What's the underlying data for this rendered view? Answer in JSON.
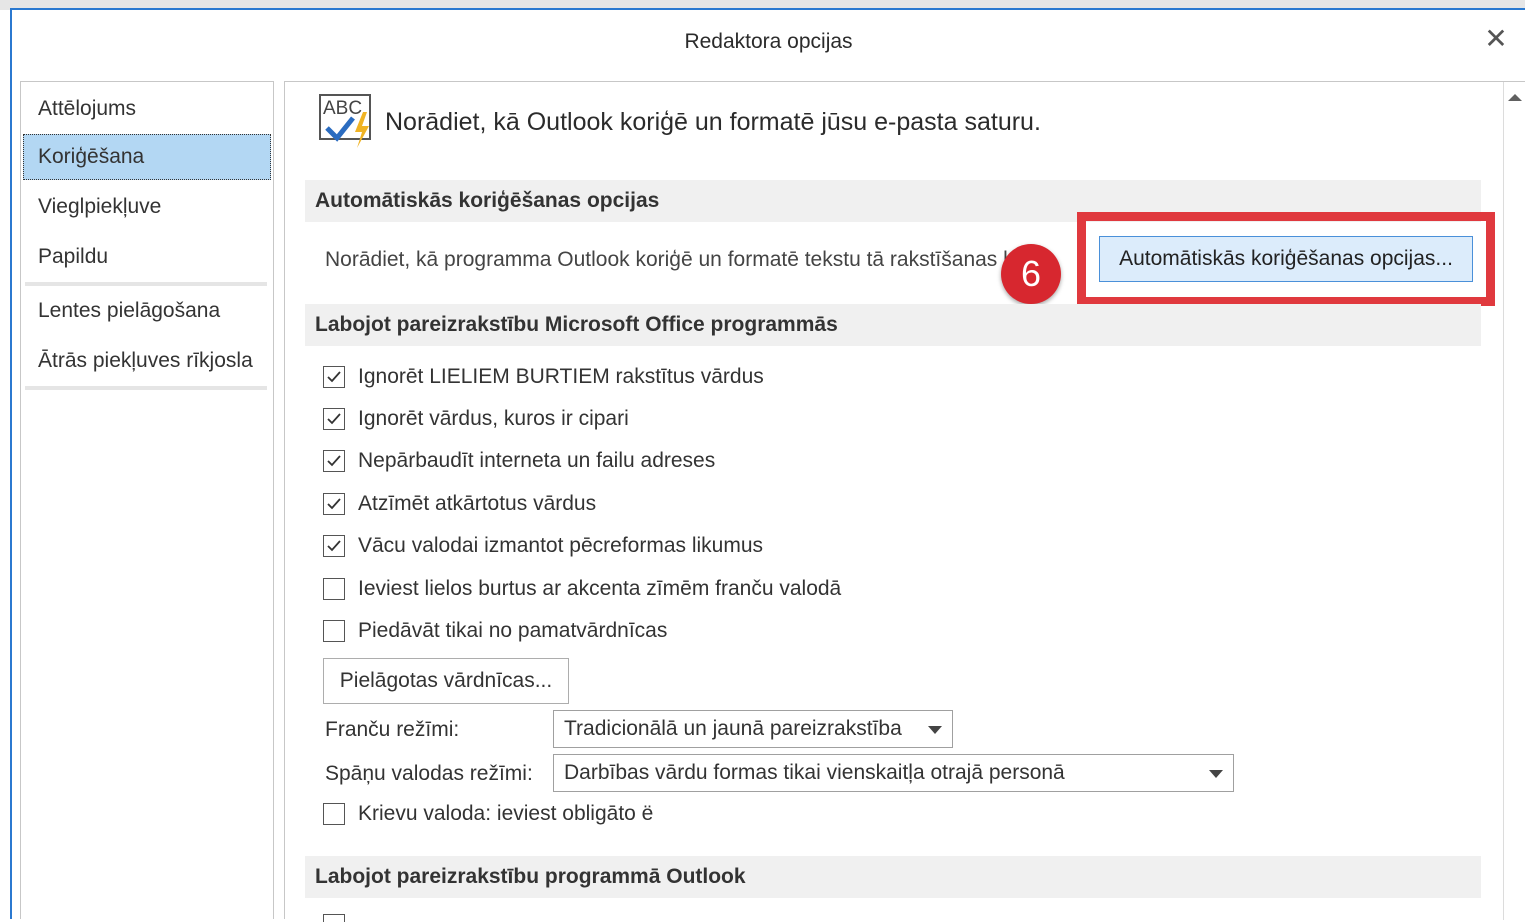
{
  "window": {
    "title": "Redaktora opcijas",
    "close_icon": "close-icon"
  },
  "sidebar": {
    "items": [
      {
        "label": "Attēlojums",
        "selected": false
      },
      {
        "label": "Koriģēšana",
        "selected": true
      },
      {
        "label": "Vieglpiekļuve",
        "selected": false
      },
      {
        "label": "Papildu",
        "selected": false
      },
      {
        "label": "Lentes pielāgošana",
        "selected": false
      },
      {
        "label": "Ātrās piekļuves rīkjosla",
        "selected": false
      }
    ]
  },
  "main": {
    "headline": "Norādiet, kā Outlook koriģē un formatē jūsu e-pasta saturu.",
    "autocorrect_section": {
      "title": "Automātiskās koriģēšanas opcijas",
      "description": "Norādiet, kā programma Outlook koriģē un formatē tekstu tā rakstīšanas laikā",
      "button_label": "Automātiskās koriģēšanas opcijas..."
    },
    "step_badge": "6",
    "office_spelling_section": {
      "title": "Labojot pareizrakstību Microsoft Office programmās",
      "options": [
        {
          "label": "Ignorēt LIELIEM BURTIEM rakstītus vārdus",
          "checked": true
        },
        {
          "label": "Ignorēt vārdus, kuros ir cipari",
          "checked": true
        },
        {
          "label": "Nepārbaudīt interneta un failu adreses",
          "checked": true
        },
        {
          "label": "Atzīmēt atkārtotus vārdus",
          "checked": true
        },
        {
          "label": "Vācu valodai izmantot pēcreformas likumus",
          "checked": true
        },
        {
          "label": "Ieviest lielos burtus ar akcenta zīmēm franču valodā",
          "checked": false
        },
        {
          "label": "Piedāvāt tikai no pamatvārdnīcas",
          "checked": false
        }
      ],
      "custom_dictionaries_button": "Pielāgotas vārdnīcas...",
      "french_modes_label": "Franču režīmi:",
      "french_modes_value": "Tradicionālā un jaunā pareizrakstība",
      "spanish_modes_label": "Spāņu valodas režīmi:",
      "spanish_modes_value": "Darbības vārdu formas tikai vienskaitļa otrajā personā",
      "russian_option": {
        "label": "Krievu valoda: ieviest obligāto ë",
        "checked": false
      }
    },
    "outlook_spelling_section": {
      "title": "Labojot pareizrakstību programmā Outlook"
    }
  },
  "colors": {
    "accent_border": "#2b79d0",
    "selected_nav": "#b3d7f3",
    "highlight_red": "#e0393e",
    "badge_red": "#d7272f",
    "checkmark": "#333333"
  }
}
